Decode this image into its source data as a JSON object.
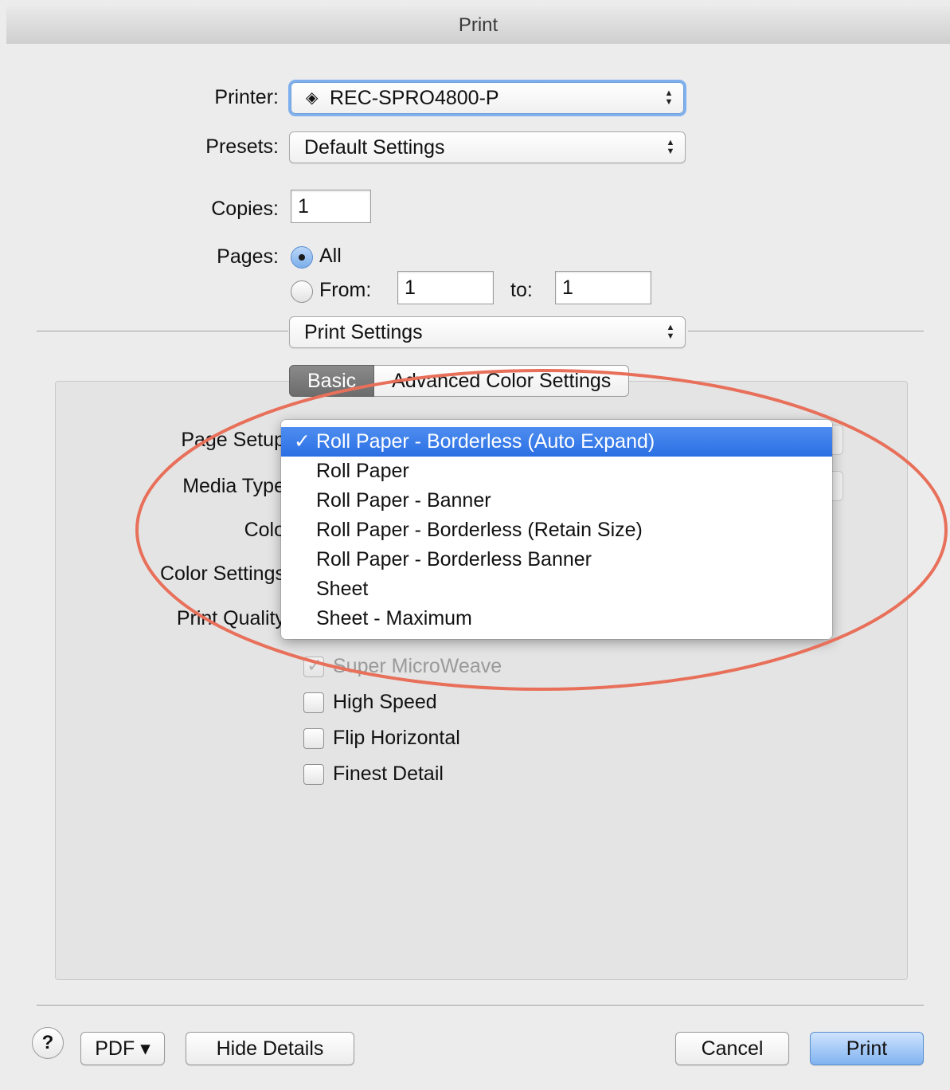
{
  "window": {
    "title": "Print"
  },
  "printer": {
    "label": "Printer:",
    "value": "REC-SPRO4800-P"
  },
  "presets": {
    "label": "Presets:",
    "value": "Default Settings"
  },
  "copies": {
    "label": "Copies:",
    "value": "1"
  },
  "pages": {
    "label": "Pages:",
    "all_label": "All",
    "from_label": "From:",
    "from_value": "1",
    "to_label": "to:",
    "to_value": "1",
    "selected": "All"
  },
  "section_popup": {
    "value": "Print Settings"
  },
  "tabs": [
    {
      "label": "Basic",
      "selected": true
    },
    {
      "label": "Advanced Color Settings",
      "selected": false
    }
  ],
  "settings": {
    "page_setup_label": "Page Setup",
    "media_type_label": "Media Type",
    "color_label": "Colo",
    "color_settings_label": "Color Settings",
    "print_quality_label": "Print Quality"
  },
  "checkboxes": [
    {
      "label": "Super MicroWeave",
      "checked": true,
      "enabled": false
    },
    {
      "label": "High Speed",
      "checked": false,
      "enabled": true
    },
    {
      "label": "Flip Horizontal",
      "checked": false,
      "enabled": true
    },
    {
      "label": "Finest Detail",
      "checked": false,
      "enabled": true
    }
  ],
  "page_setup_menu": {
    "check_mark": "✓",
    "items": [
      "Roll Paper - Borderless (Auto Expand)",
      "Roll Paper",
      "Roll Paper - Banner",
      "Roll Paper - Borderless (Retain Size)",
      "Roll Paper - Borderless Banner",
      "Sheet",
      "Sheet - Maximum"
    ],
    "selected_index": 0
  },
  "footer": {
    "help_label": "?",
    "pdf_label": "PDF ▾",
    "hide_details_label": "Hide Details",
    "cancel_label": "Cancel",
    "print_label": "Print"
  },
  "colors": {
    "accent": "#2a6ee3",
    "annotation_oval": "#e8705a",
    "window_bg": "#ececec"
  }
}
